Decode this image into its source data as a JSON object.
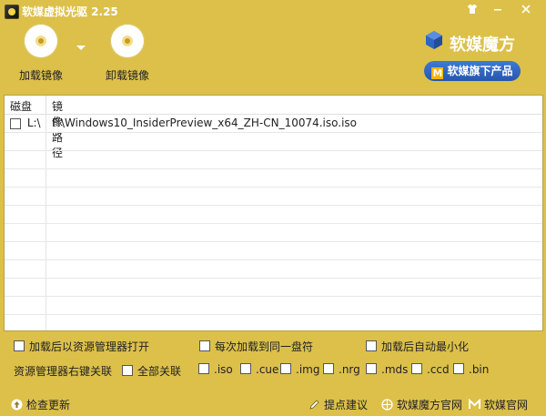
{
  "window": {
    "title": "软媒虚拟光驱 2.25"
  },
  "toolbar": {
    "load_label": "加载镜像",
    "unload_label": "卸载镜像"
  },
  "brand": {
    "logo_text": "软媒魔方",
    "promo_label": "软媒旗下产品",
    "promo_badge": "M"
  },
  "list": {
    "col_disk": "磁盘",
    "col_path": "镜像路径",
    "rows": [
      {
        "disk": "L:\\",
        "path": "F:\\Windows10_InsiderPreview_x64_ZH-CN_10074.iso.iso"
      }
    ]
  },
  "options": {
    "open_explorer": "加载后以资源管理器打开",
    "same_drive": "每次加载到同一盘符",
    "minimize": "加载后自动最小化",
    "context_menu_label": "资源管理器右键关联",
    "all_assoc": "全部关联",
    "exts": [
      ".iso",
      ".cue",
      ".img",
      ".nrg",
      ".mds",
      ".ccd",
      ".bin"
    ]
  },
  "statusbar": {
    "check_update": "检查更新",
    "feedback": "提点建议",
    "mofang_site": "软媒魔方官网",
    "ruanmei_site": "软媒官网"
  },
  "colors": {
    "chrome": "#dcc04a",
    "accent": "#ff9b1f",
    "promo_blue": "#2f65c3"
  }
}
